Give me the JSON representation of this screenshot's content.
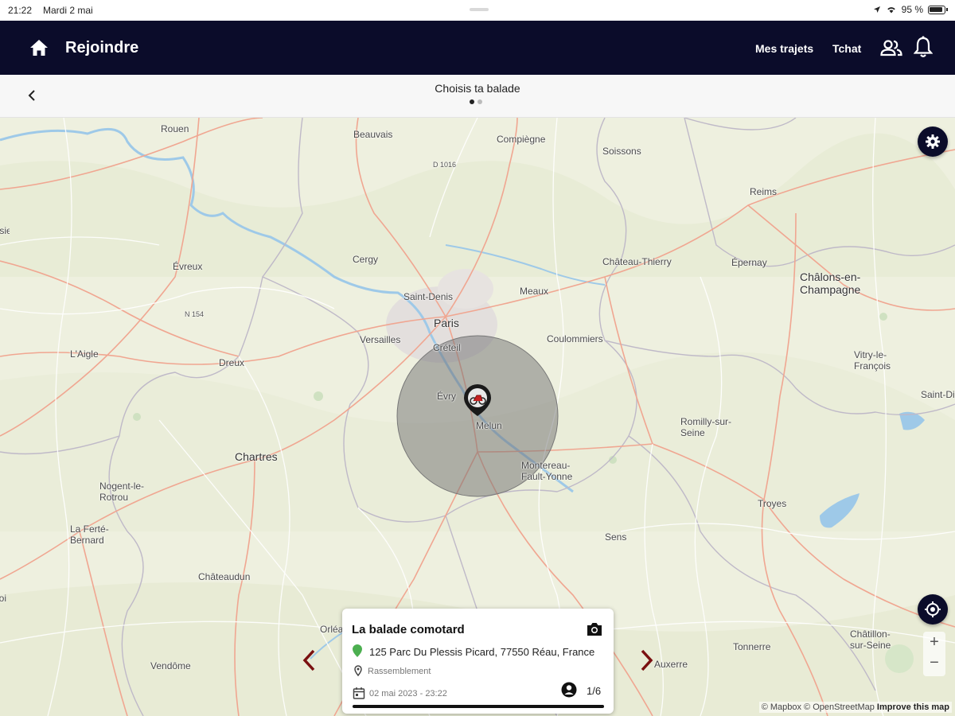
{
  "status_bar": {
    "time": "21:22",
    "date": "Mardi 2 mai",
    "battery": "95 %"
  },
  "app_bar": {
    "title": "Rejoindre",
    "nav": [
      "Mes trajets",
      "Tchat"
    ]
  },
  "sub_header": {
    "title": "Choisis ta balade",
    "page_index": 1,
    "page_count": 2
  },
  "map": {
    "cities": [
      "Rouen",
      "Beauvais",
      "Compiègne",
      "Soissons",
      "Reims",
      "Évreux",
      "Cergy",
      "Château-Thierry",
      "Épernay",
      "Châlons-en-Champagne",
      "Saint-Denis",
      "Meaux",
      "Paris",
      "Versailles",
      "Créteil",
      "Coulommiers",
      "L'Aigle",
      "Dreux",
      "Évry",
      "Melun",
      "Vitry-le-François",
      "Saint-Dizier",
      "Romilly-sur-Seine",
      "Chartres",
      "Nogent-le-Rotrou",
      "Montereau-Fault-Yonne",
      "Troyes",
      "La Ferté-Bernard",
      "Sens",
      "Châteaudun",
      "Vendôme",
      "Orléans",
      "Auxerre",
      "Tonnerre",
      "Châtillon-sur-Seine",
      "Lisieux",
      "Blois"
    ],
    "road_labels": [
      "D 1016",
      "N 154"
    ],
    "attribution": {
      "text": "© Mapbox © OpenStreetMap",
      "link": "Improve this map"
    },
    "zoom_in": "+",
    "zoom_out": "−"
  },
  "card": {
    "title": "La balade comotard",
    "address": "125 Parc Du Plessis Picard, 77550 Réau, France",
    "type": "Rassemblement",
    "date": "02 mai 2023 - 23:22",
    "participants": "1/6",
    "progress": 1.0
  },
  "colors": {
    "primary": "#0b0c2a",
    "pin_green": "#4caf50",
    "arrow_red": "#7a1010"
  }
}
